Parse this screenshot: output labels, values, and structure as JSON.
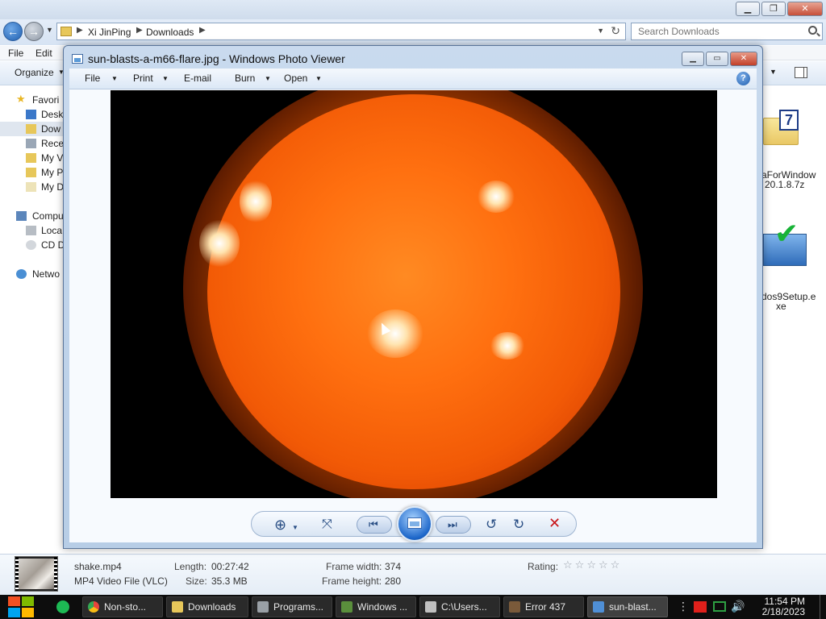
{
  "explorer": {
    "breadcrumb": [
      "Xi JinPing",
      "Downloads"
    ],
    "search_placeholder": "Search Downloads",
    "menu": [
      "File",
      "Edit"
    ],
    "toolbar_organize": "Organize",
    "nav_pane": {
      "favorites": "Favori",
      "items_fav": [
        "Desk",
        "Dow",
        "Rece",
        "My V",
        "My P",
        "My D"
      ],
      "computer": "Compu",
      "items_comp": [
        "Loca",
        "CD D"
      ],
      "network": "Netwo"
    },
    "files": [
      {
        "name_line1": "aForWindow",
        "name_line2": "20.1.8.7z"
      },
      {
        "name_line1": "dos9Setup.e",
        "name_line2": "xe"
      }
    ],
    "details": {
      "name": "shake.mp4",
      "type": "MP4 Video File (VLC)",
      "length_label": "Length:",
      "length_value": "00:27:42",
      "size_label": "Size:",
      "size_value": "35.3 MB",
      "frame_width_label": "Frame width:",
      "frame_width_value": "374",
      "frame_height_label": "Frame height:",
      "frame_height_value": "280",
      "rating_label": "Rating:",
      "rating_stars": 5,
      "rating_value": 0
    }
  },
  "viewer": {
    "title": "sun-blasts-a-m66-flare.jpg - Windows Photo Viewer",
    "menu": [
      {
        "label": "File",
        "has_dropdown": true
      },
      {
        "label": "Print",
        "has_dropdown": true
      },
      {
        "label": "E-mail",
        "has_dropdown": false
      },
      {
        "label": "Burn",
        "has_dropdown": true
      },
      {
        "label": "Open",
        "has_dropdown": true
      }
    ],
    "help_glyph": "?",
    "controls": [
      "zoom-icon",
      "fit-window-icon",
      "previous-icon",
      "slideshow-icon",
      "next-icon",
      "rotate-ccw-icon",
      "rotate-cw-icon",
      "delete-icon"
    ]
  },
  "taskbar": {
    "buttons": [
      {
        "label": "Non-sto...",
        "icon_color": "#e8453c",
        "active": false
      },
      {
        "label": "Downloads",
        "icon_color": "#e7c75a",
        "active": false
      },
      {
        "label": "Programs...",
        "icon_color": "#9aa0a6",
        "active": false
      },
      {
        "label": "Windows ...",
        "icon_color": "#5a8f3c",
        "active": false
      },
      {
        "label": "C:\\Users...",
        "icon_color": "#c0c0c0",
        "active": false
      },
      {
        "label": "Error 437",
        "icon_color": "#7a5a3a",
        "active": false
      },
      {
        "label": "sun-blast...",
        "icon_color": "#4f8fd6",
        "active": true
      }
    ],
    "time": "11:54 PM",
    "date": "2/18/2023"
  }
}
